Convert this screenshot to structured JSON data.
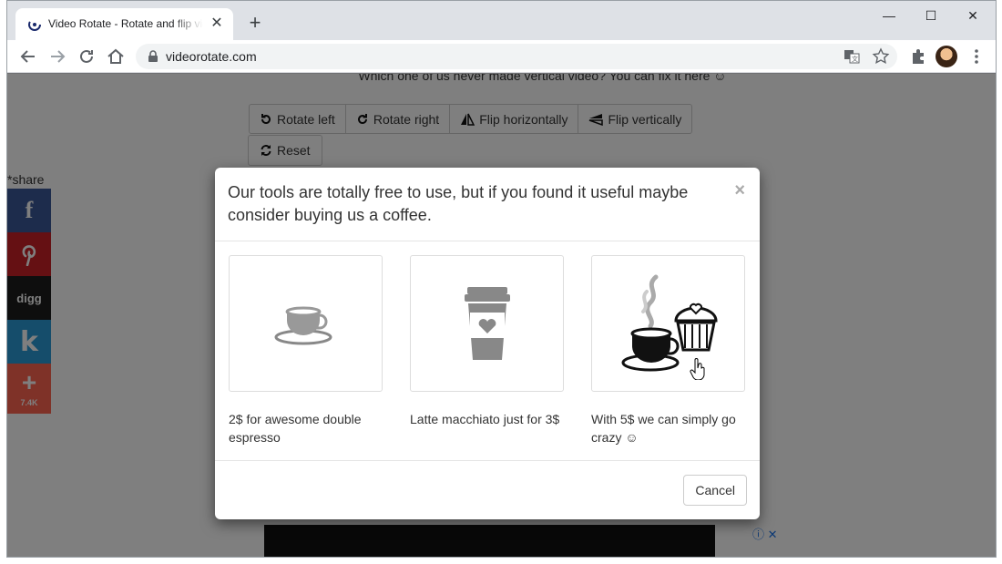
{
  "browser": {
    "tab_title": "Video Rotate - Rotate and flip video",
    "url": "videorotate.com",
    "window_controls": {
      "minimize": "—",
      "maximize": "☐",
      "close": "✕"
    }
  },
  "page": {
    "subtitle": "Which one of us never made vertical video? You can fix it here ☺",
    "buttons": [
      {
        "label": "Rotate left",
        "icon": "rotate-left-icon"
      },
      {
        "label": "Rotate right",
        "icon": "rotate-right-icon"
      },
      {
        "label": "Flip horizontally",
        "icon": "flip-horizontal-icon"
      },
      {
        "label": "Flip vertically",
        "icon": "flip-vertical-icon"
      }
    ],
    "reset_label": "Reset",
    "share_label": "*share",
    "share_buttons": [
      {
        "name": "facebook",
        "glyph": "f",
        "color": "#3b5998"
      },
      {
        "name": "pinterest",
        "glyph": "P",
        "color": "#cb2027"
      },
      {
        "name": "digg",
        "glyph": "digg",
        "color": "#1c1c1c"
      },
      {
        "name": "kik",
        "glyph": "k",
        "color": "#2a9ad6"
      },
      {
        "name": "more",
        "glyph": "+",
        "count": "7.4K",
        "color": "#ff6550"
      }
    ]
  },
  "modal": {
    "title": "Our tools are totally free to use, but if you found it useful maybe consider buying us a coffee.",
    "close_label": "×",
    "options": [
      {
        "caption": "2$ for awesome double espresso",
        "icon": "espresso-cup-icon"
      },
      {
        "caption": "Latte macchiato just for 3$",
        "icon": "takeaway-cup-icon"
      },
      {
        "caption": "With 5$ we can simply go crazy ☺",
        "icon": "coffee-muffin-icon"
      }
    ],
    "cancel_label": "Cancel"
  }
}
